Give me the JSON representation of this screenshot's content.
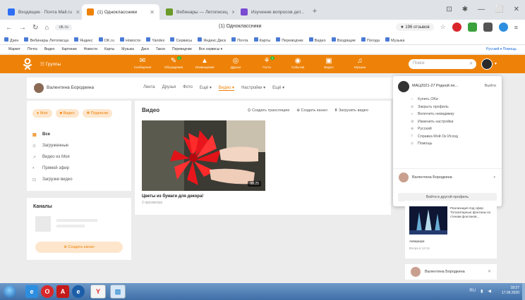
{
  "browser": {
    "tabs": [
      {
        "label": "Входящие · Почта Mail.ru",
        "favicon_color": "#2f6ef5"
      },
      {
        "label": "(1) Одноклассники",
        "favicon_color": "#ee8208"
      },
      {
        "label": "Вебинары — Летописец",
        "favicon_color": "#6a9a2a"
      },
      {
        "label": "Изучение вопросов дет...",
        "favicon_color": "#7a4ad0"
      }
    ],
    "new_tab": "+",
    "window_controls": [
      "⊡",
      "✱",
      "—",
      "⬜",
      "✕"
    ],
    "address_pill": "ok.ru",
    "page_title": "(1) Одноклассники",
    "rating": "★ 196 отзывов",
    "bookmarks": [
      "Дзен",
      "Вебинары Летописца",
      "Яндекс",
      "OK.ru",
      "Новости",
      "Yandex",
      "Сервисы",
      "Яндекс.Диск",
      "Почта",
      "Карты",
      "Переводчик",
      "Видео",
      "Входящие",
      "Погода",
      "Музыка"
    ],
    "services": [
      "Маркет",
      "Почта",
      "Видео",
      "Картинки",
      "Новости",
      "Карты",
      "Музыка",
      "Диск",
      "Такси",
      "Переводчик",
      "Все сервисы ▾"
    ],
    "services_right": "Русский ▾  Помощь"
  },
  "ok": {
    "groups_label": "Группы",
    "nav": [
      {
        "label": "Сообщения",
        "icon": "messages-icon",
        "glyph": "✉",
        "badge": ""
      },
      {
        "label": "Обсуждения",
        "icon": "discussions-icon",
        "glyph": "✎",
        "badge": "1"
      },
      {
        "label": "Оповещения",
        "icon": "bell-icon",
        "glyph": "▲",
        "badge": ""
      },
      {
        "label": "Друзья",
        "icon": "friends-icon",
        "glyph": "◎",
        "badge": ""
      },
      {
        "label": "Гости",
        "icon": "guests-icon",
        "glyph": "⚘",
        "badge": "2"
      },
      {
        "label": "События",
        "icon": "events-icon",
        "glyph": "◉",
        "badge": ""
      },
      {
        "label": "Видео",
        "icon": "video-icon",
        "glyph": "▣",
        "badge": ""
      },
      {
        "label": "Музыка",
        "icon": "music-icon",
        "glyph": "♫",
        "badge": ""
      }
    ],
    "search_placeholder": "Поиск",
    "brand_color": "#ee8208"
  },
  "profile": {
    "name": "Валентина Бородкина",
    "tabs": [
      "Лента",
      "Друзья",
      "Фото",
      "Ещё ▾",
      "Видео ▾",
      "Настройки ▾",
      "Ещё ▾"
    ],
    "active_tab_index": 4
  },
  "sidebar": {
    "top_buttons": [
      {
        "label": "Моё",
        "icon": "user-icon",
        "glyph": "●"
      },
      {
        "label": "Видео",
        "icon": "video-cam-icon",
        "glyph": "■"
      },
      {
        "label": "Подписки",
        "icon": "subscribe-icon",
        "glyph": "✚"
      }
    ],
    "menu": [
      {
        "label": "Все",
        "icon": "all-icon",
        "glyph": "▤"
      },
      {
        "label": "Загруженные",
        "icon": "upload-icon",
        "glyph": "⊙"
      },
      {
        "label": "Видео из Моя",
        "icon": "mine-icon",
        "glyph": "↗"
      },
      {
        "label": "Прямой эфир",
        "icon": "live-icon",
        "glyph": "◐"
      },
      {
        "label": "Загрузки видео",
        "icon": "download-icon",
        "glyph": "⊡"
      }
    ],
    "channels_title": "Каналы",
    "create_channel": "Создать канал"
  },
  "main": {
    "title": "Видео",
    "actions": [
      {
        "label": "Создать трансляцию",
        "glyph": "⛭"
      },
      {
        "label": "Создать канал",
        "glyph": "⊕"
      },
      {
        "label": "Загрузить видео",
        "glyph": "⬆"
      }
    ],
    "video": {
      "caption": "Цветы из бумаги для декора!",
      "duration": "08:25",
      "views": "2 просмотра"
    }
  },
  "dropdown": {
    "account": "МАЦ2021-27 Родной ле...",
    "exit": "Выйти",
    "items": [
      {
        "label": "Купить OKи",
        "glyph": "○"
      },
      {
        "label": "Закрыть профиль",
        "glyph": "⊘"
      },
      {
        "label": "Включить невидимку",
        "glyph": "◑"
      },
      {
        "label": "Изменить настройки",
        "glyph": "⚙"
      },
      {
        "label": "Русский",
        "glyph": "⊕"
      },
      {
        "label": "Справка Мой Ок Исход",
        "glyph": "?"
      },
      {
        "label": "Помощь",
        "glyph": "⊙"
      }
    ],
    "user": "Валентина Бородкина",
    "login_other": "Войти в другой профиль"
  },
  "recommend": {
    "text": "Реализация под сфер Тоталитарные фонтаны по стенам фонтанов...",
    "title": "Аквариум",
    "date": "Вчера в 12:14",
    "user_name": "Валентина Бородкина"
  },
  "taskbar": {
    "apps": [
      {
        "icon": "ie-icon",
        "glyph": "e",
        "color": "#2d8ee0"
      },
      {
        "icon": "opera-icon",
        "glyph": "O",
        "color": "#d9282a"
      },
      {
        "icon": "acrobat-icon",
        "glyph": "A",
        "color": "#c41a1a"
      },
      {
        "icon": "edge-icon",
        "glyph": "e",
        "color": "#1c5ea8"
      },
      {
        "icon": "yandex-icon",
        "glyph": "Y",
        "color": "#e02020"
      },
      {
        "icon": "image-viewer-icon",
        "glyph": "▧",
        "color": "#3a8fd0"
      }
    ],
    "language": "RU",
    "time": "18:27",
    "date": "17.06.2020"
  }
}
